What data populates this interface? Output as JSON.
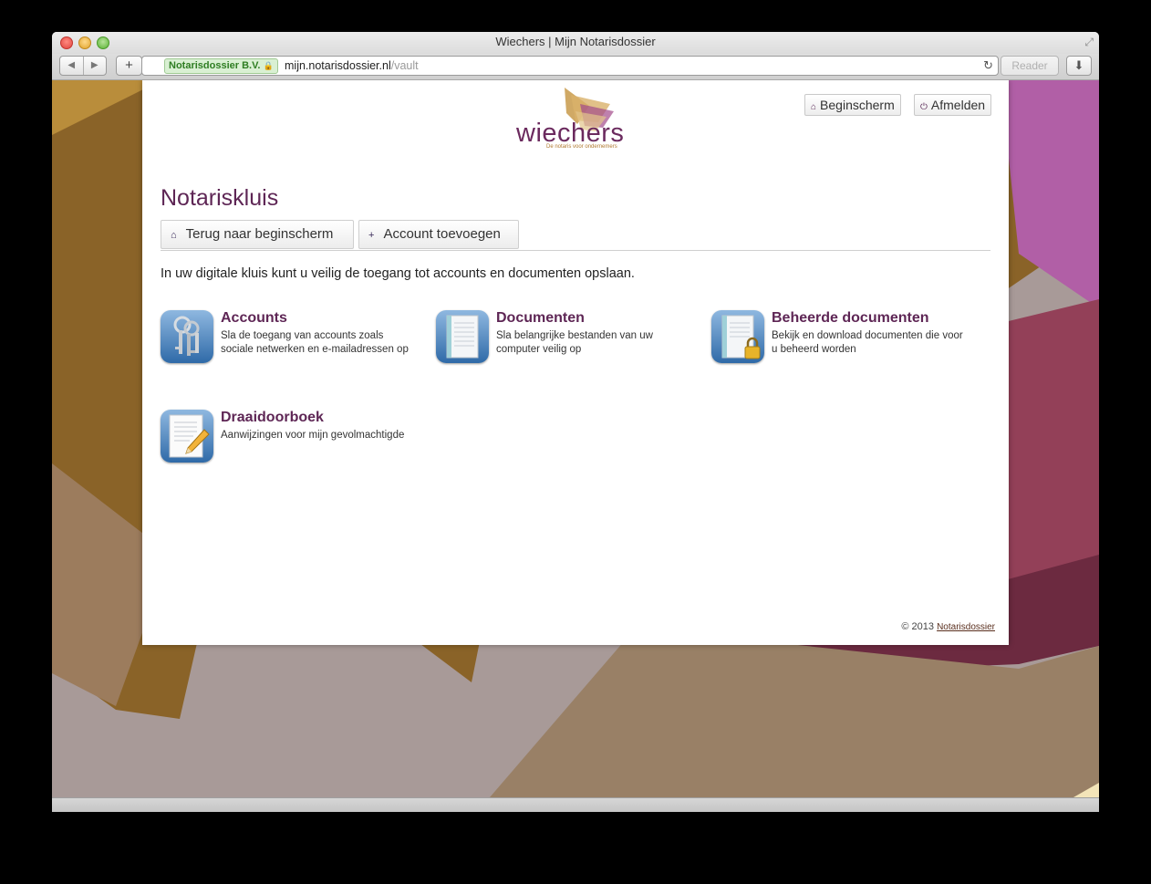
{
  "window": {
    "title": "Wiechers | Mijn Notarisdossier"
  },
  "toolbar": {
    "back_icon": "◀",
    "forward_icon": "▶",
    "new_tab_icon": "+",
    "ev_cert": "Notarisdossier B.V.",
    "lock_icon": "🔒",
    "url_host": "mijn.notarisdossier.nl",
    "url_path": "/vault",
    "reload_icon": "↻",
    "reader_label": "Reader",
    "download_icon": "⬇",
    "fullscreen_icon": "⤢"
  },
  "header": {
    "logo_text": "wiechers",
    "logo_tagline": "De notaris voor ondernemers",
    "home_button": "Beginscherm",
    "home_icon": "⌂",
    "logout_button": "Afmelden",
    "logout_icon": "⏻"
  },
  "main": {
    "title": "Notariskluis",
    "back_button": "Terug naar beginscherm",
    "back_icon": "⌂",
    "add_button": "Account toevoegen",
    "add_icon": "+",
    "intro": "In uw digitale kluis kunt u veilig de toegang tot accounts en documenten opslaan.",
    "tiles": [
      {
        "title": "Accounts",
        "desc": "Sla de toegang van accounts zoals sociale netwerken en e-mailadressen op",
        "icon": "keys-icon"
      },
      {
        "title": "Documenten",
        "desc": "Sla belangrijke bestanden van uw computer veilig op",
        "icon": "document-icon"
      },
      {
        "title": "Beheerde documenten",
        "desc": "Bekijk en download documenten die voor u beheerd worden",
        "icon": "locked-document-icon"
      },
      {
        "title": "Draaidoorboek",
        "desc": "Aanwijzingen voor mijn gevolmachtigde",
        "icon": "notebook-pencil-icon"
      }
    ]
  },
  "footer": {
    "copyright": "© 2013",
    "link": "Notarisdossier"
  },
  "colors": {
    "brand_purple": "#5e2655",
    "logo_gold": "#c89a4a"
  }
}
